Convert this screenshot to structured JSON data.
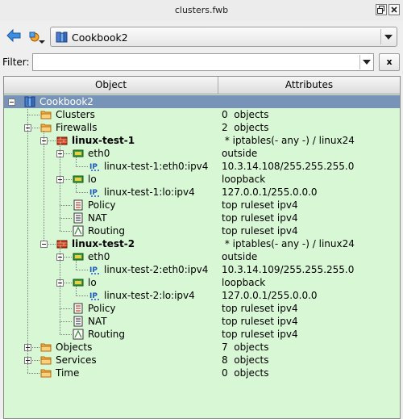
{
  "window": {
    "title": "clusters.fwb"
  },
  "toolbar": {
    "library": "Cookbook2"
  },
  "filter": {
    "label": "Filter:",
    "value": "",
    "clear_label": "x"
  },
  "tree": {
    "columns": {
      "object": "Object",
      "attributes": "Attributes"
    },
    "rows": [
      {
        "name": "Cookbook2",
        "attr": "",
        "icon": "library"
      },
      {
        "name": "Clusters",
        "attr": "0  objects",
        "icon": "folder"
      },
      {
        "name": "Firewalls",
        "attr": "2  objects",
        "icon": "folder"
      },
      {
        "name": "linux-test-1",
        "attr": " * iptables(- any -) / linux24",
        "icon": "firewall"
      },
      {
        "name": "eth0",
        "attr": "outside",
        "icon": "interface"
      },
      {
        "name": "linux-test-1:eth0:ipv4",
        "attr": "10.3.14.108/255.255.255.0",
        "icon": "ipv4"
      },
      {
        "name": "lo",
        "attr": "loopback",
        "icon": "interface"
      },
      {
        "name": "linux-test-1:lo:ipv4",
        "attr": "127.0.0.1/255.0.0.0",
        "icon": "ipv4"
      },
      {
        "name": "Policy",
        "attr": "top ruleset ipv4",
        "icon": "policy"
      },
      {
        "name": "NAT",
        "attr": "top ruleset ipv4",
        "icon": "nat"
      },
      {
        "name": "Routing",
        "attr": "top ruleset ipv4",
        "icon": "routing"
      },
      {
        "name": "linux-test-2",
        "attr": " * iptables(- any -) / linux24",
        "icon": "firewall"
      },
      {
        "name": "eth0",
        "attr": "outside",
        "icon": "interface"
      },
      {
        "name": "linux-test-2:eth0:ipv4",
        "attr": "10.3.14.109/255.255.255.0",
        "icon": "ipv4"
      },
      {
        "name": "lo",
        "attr": "loopback",
        "icon": "interface"
      },
      {
        "name": "linux-test-2:lo:ipv4",
        "attr": "127.0.0.1/255.0.0.0",
        "icon": "ipv4"
      },
      {
        "name": "Policy",
        "attr": "top ruleset ipv4",
        "icon": "policy"
      },
      {
        "name": "NAT",
        "attr": "top ruleset ipv4",
        "icon": "nat"
      },
      {
        "name": "Routing",
        "attr": "top ruleset ipv4",
        "icon": "routing"
      },
      {
        "name": "Objects",
        "attr": "7  objects",
        "icon": "folder"
      },
      {
        "name": "Services",
        "attr": "8  objects",
        "icon": "folder"
      },
      {
        "name": "Time",
        "attr": "0  objects",
        "icon": "folder"
      }
    ]
  },
  "colors": {
    "tree_bg": "#d8f7d4",
    "selection": "#7794b8"
  }
}
